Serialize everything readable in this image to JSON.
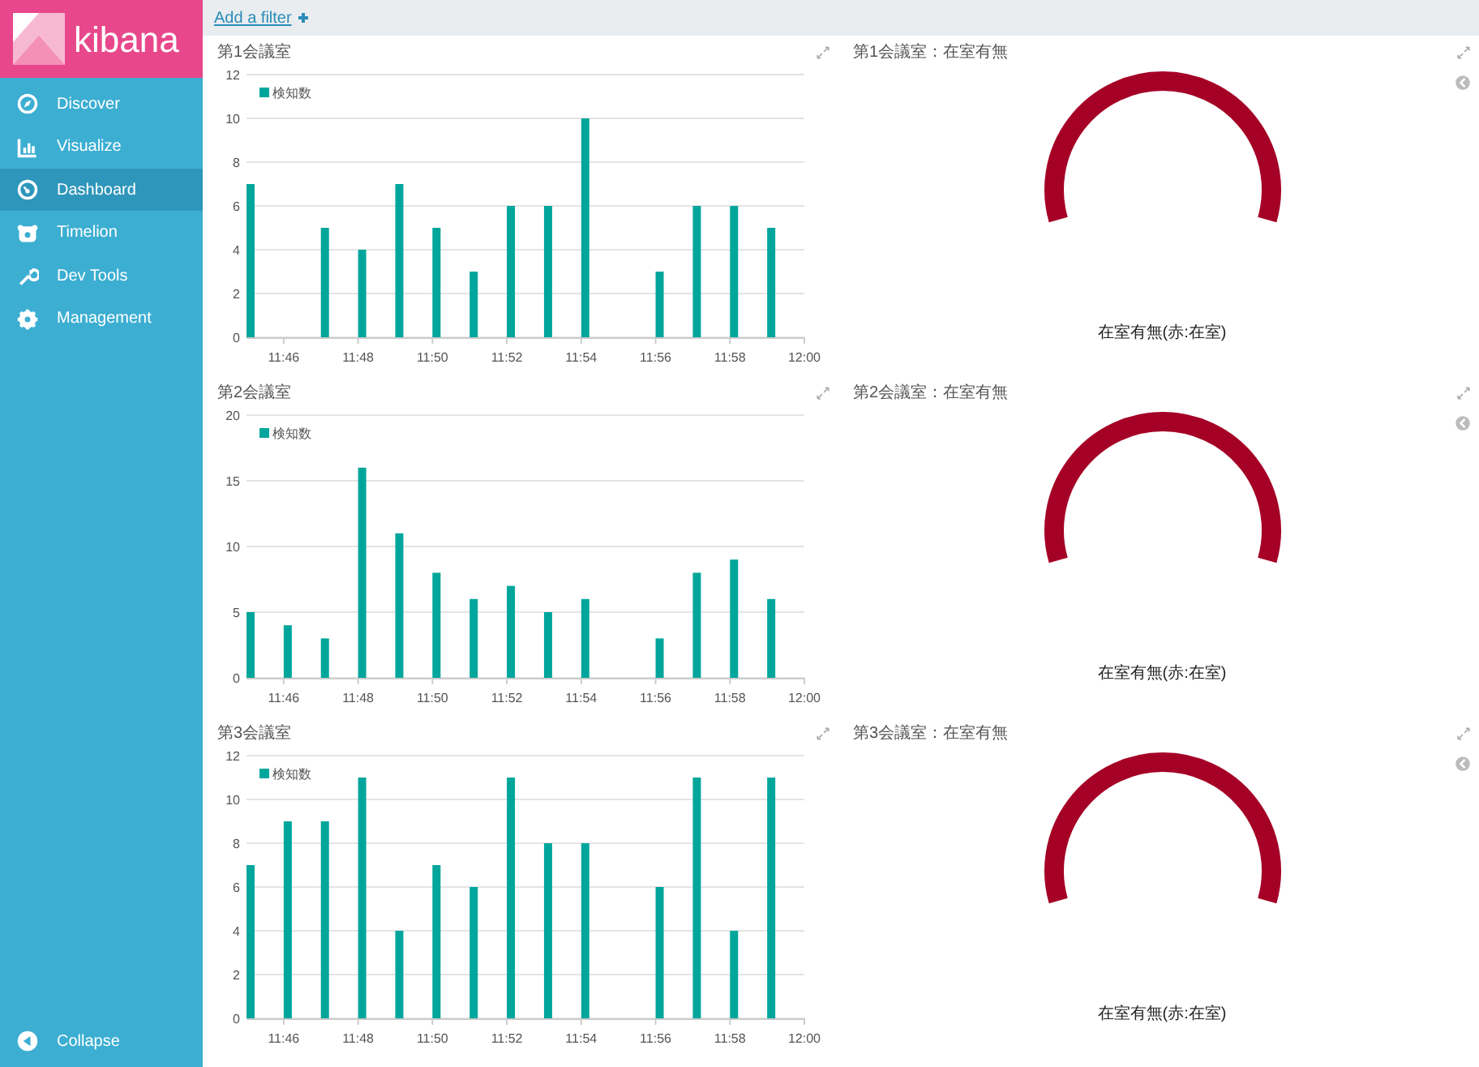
{
  "sidebar": {
    "logo": "kibana",
    "items": [
      {
        "label": "Discover",
        "selected": false
      },
      {
        "label": "Visualize",
        "selected": false
      },
      {
        "label": "Dashboard",
        "selected": true
      },
      {
        "label": "Timelion",
        "selected": false
      },
      {
        "label": "Dev Tools",
        "selected": false
      },
      {
        "label": "Management",
        "selected": false
      }
    ],
    "collapse": "Collapse"
  },
  "filter_bar": {
    "add_filter": "Add a filter"
  },
  "panels": [
    {
      "kind": "bar",
      "title": "第1会議室",
      "chart_data": {
        "type": "bar",
        "grid": true,
        "categories": [
          null,
          "11:46",
          null,
          "11:48",
          null,
          "11:50",
          null,
          "11:52",
          null,
          "11:54",
          null,
          "11:56",
          null,
          "11:58",
          null,
          "12:00"
        ],
        "series": [
          {
            "name": "検知数",
            "color": "#00a69b",
            "values": [
              7,
              null,
              5,
              4,
              7,
              5,
              3,
              6,
              6,
              10,
              null,
              3,
              6,
              6,
              5,
              null
            ]
          }
        ],
        "ylim": [
          0,
          12
        ],
        "yticks": [
          0,
          2,
          4,
          6,
          8,
          10,
          12
        ]
      }
    },
    {
      "kind": "gauge",
      "title": "第1会議室：在室有無",
      "label": "在室有無(赤:在室)",
      "color": "#a50026"
    },
    {
      "kind": "bar",
      "title": "第2会議室",
      "chart_data": {
        "type": "bar",
        "grid": true,
        "categories": [
          null,
          "11:46",
          null,
          "11:48",
          null,
          "11:50",
          null,
          "11:52",
          null,
          "11:54",
          null,
          "11:56",
          null,
          "11:58",
          null,
          "12:00"
        ],
        "series": [
          {
            "name": "検知数",
            "color": "#00a69b",
            "values": [
              5,
              4,
              3,
              16,
              11,
              8,
              6,
              7,
              5,
              6,
              null,
              3,
              8,
              9,
              6,
              null
            ]
          }
        ],
        "ylim": [
          0,
          20
        ],
        "yticks": [
          0,
          5,
          10,
          15,
          20
        ]
      }
    },
    {
      "kind": "gauge",
      "title": "第2会議室：在室有無",
      "label": "在室有無(赤:在室)",
      "color": "#a50026"
    },
    {
      "kind": "bar",
      "title": "第3会議室",
      "chart_data": {
        "type": "bar",
        "grid": true,
        "categories": [
          null,
          "11:46",
          null,
          "11:48",
          null,
          "11:50",
          null,
          "11:52",
          null,
          "11:54",
          null,
          "11:56",
          null,
          "11:58",
          null,
          "12:00"
        ],
        "series": [
          {
            "name": "検知数",
            "color": "#00a69b",
            "values": [
              7,
              9,
              9,
              11,
              4,
              7,
              6,
              11,
              8,
              8,
              null,
              6,
              11,
              4,
              11,
              null
            ]
          }
        ],
        "ylim": [
          0,
          12
        ],
        "yticks": [
          0,
          2,
          4,
          6,
          8,
          10,
          12
        ]
      }
    },
    {
      "kind": "gauge",
      "title": "第3会議室：在室有無",
      "label": "在室有無(赤:在室)",
      "color": "#a50026"
    }
  ]
}
